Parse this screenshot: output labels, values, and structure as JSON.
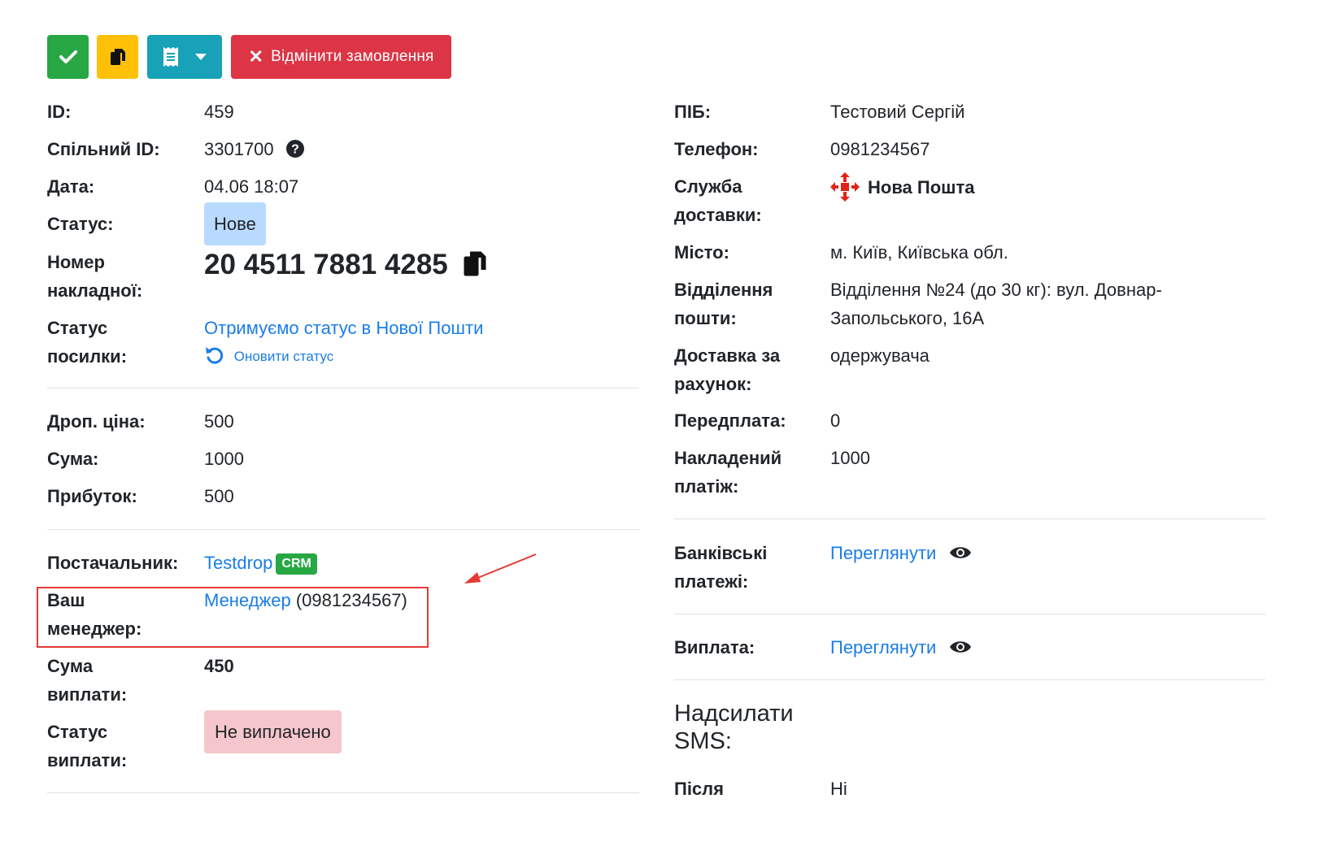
{
  "toolbar": {
    "cancel_label": "Відмінити замовлення"
  },
  "left": {
    "id_label": "ID:",
    "id_value": "459",
    "shared_id_label": "Спільний ID:",
    "shared_id_value": "3301700",
    "date_label": "Дата:",
    "date_value": "04.06 18:07",
    "status_label": "Статус:",
    "status_value": "Нове",
    "waybill_label_1": "Номер",
    "waybill_label_2": "накладної:",
    "waybill_value": "20 4511 7881 4285",
    "parcel_status_label_1": "Статус",
    "parcel_status_label_2": "посилки:",
    "parcel_status_link": "Отримуємо статус в Нової Пошти",
    "refresh_status_link": "Оновити статус",
    "drop_price_label": "Дроп. ціна:",
    "drop_price_value": "500",
    "sum_label": "Сума:",
    "sum_value": "1000",
    "profit_label": "Прибуток:",
    "profit_value": "500",
    "supplier_label": "Постачальник:",
    "supplier_link": "Testdrop",
    "supplier_badge": "CRM",
    "manager_label_1": "Ваш",
    "manager_label_2": "менеджер:",
    "manager_link": "Менеджер",
    "manager_phone": "(0981234567)",
    "payout_sum_label_1": "Сума",
    "payout_sum_label_2": "виплати:",
    "payout_sum_value": "450",
    "payout_status_label_1": "Статус",
    "payout_status_label_2": "виплати:",
    "payout_status_value": "Не виплачено"
  },
  "right": {
    "name_label": "ПІБ:",
    "name_value": "Тестовий Сергій",
    "phone_label": "Телефон:",
    "phone_value": "0981234567",
    "delivery_label_1": "Служба",
    "delivery_label_2": "доставки:",
    "delivery_value": "Нова Пошта",
    "city_label": "Місто:",
    "city_value": "м. Київ, Київська обл.",
    "branch_label_1": "Відділення",
    "branch_label_2": "пошти:",
    "branch_value_1": "Відділення №24 (до 30 кг): вул. Довнар-",
    "branch_value_2": "Запольського, 16А",
    "payer_label_1": "Доставка за",
    "payer_label_2": "рахунок:",
    "payer_value": "одержувача",
    "prepay_label": "Передплата:",
    "prepay_value": "0",
    "cod_label_1": "Накладений",
    "cod_label_2": "платіж:",
    "cod_value": "1000",
    "bank_label_1": "Банківські",
    "bank_label_2": "платежі:",
    "bank_link": "Переглянути",
    "payout_label": "Виплата:",
    "payout_link": "Переглянути",
    "sms_heading_1": "Надсилати",
    "sms_heading_2": "SMS:",
    "after_label": "Після",
    "after_value": "Ні"
  },
  "colors": {
    "success": "#28a745",
    "warning": "#ffc107",
    "info": "#17a2b8",
    "danger": "#dc3545",
    "link": "#1a7de8",
    "annotation": "#e53935"
  }
}
